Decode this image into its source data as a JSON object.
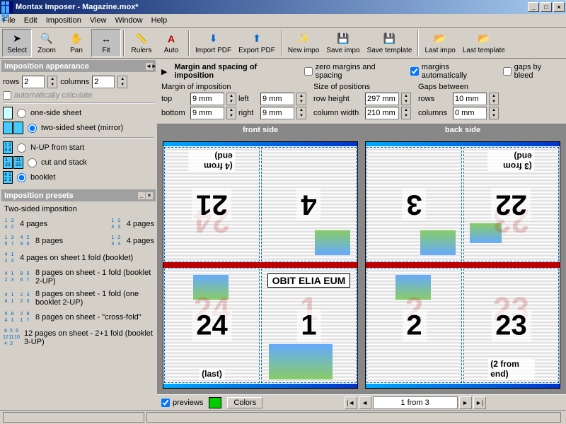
{
  "window": {
    "title": "Montax Imposer - Magazine.mox*"
  },
  "menu": {
    "file": "File",
    "edit": "Edit",
    "imposition": "Imposition",
    "view": "View",
    "window": "Window",
    "help": "Help"
  },
  "toolbar": {
    "select": "Select",
    "zoom": "Zoom",
    "pan": "Pan",
    "fit": "Fit",
    "rulers": "Rulers",
    "auto": "Auto",
    "importpdf": "Import PDF",
    "exportpdf": "Export PDF",
    "newimpo": "New impo",
    "saveimpo": "Save impo",
    "savetemplate": "Save template",
    "lastimpo": "Last impo",
    "lasttemplate": "Last template"
  },
  "appearance": {
    "header": "Imposition appearance",
    "rows_lbl": "rows",
    "rows_val": "2",
    "cols_lbl": "columns",
    "cols_val": "2",
    "autocalc": "automatically calculate",
    "oneside": "one-side sheet",
    "twoside": "two-sided sheet (mirror)",
    "nup": "N-UP from start",
    "cutstack": "cut and stack",
    "booklet": "booklet"
  },
  "presets": {
    "header": "Imposition presets",
    "subheader": "Two-sided imposition",
    "items": [
      "4 pages",
      "4 pages",
      "8 pages",
      "4 pages",
      "4 pages on sheet 1 fold (booklet)",
      "8 pages on sheet - 1 fold (booklet 2-UP)",
      "8 pages on sheet - 1 fold (one booklet 2-UP)",
      "8 pages on sheet - \"cross-fold\"",
      "12 pages on sheet - 2+1 fold (booklet 3-UP)"
    ]
  },
  "marginPanel": {
    "title": "Margin and spacing of imposition",
    "zero": "zero margins and spacing",
    "auto": "margins automatically",
    "gapsbleed": "gaps by bleed",
    "marginOf": "Margin of imposition",
    "top": "top",
    "top_v": "9 mm",
    "left": "left",
    "left_v": "9 mm",
    "bottom": "bottom",
    "bottom_v": "9 mm",
    "right": "right",
    "right_v": "9 mm",
    "sizeOf": "Size of positions",
    "rowh": "row height",
    "rowh_v": "297 mm",
    "colw": "column width",
    "colw_v": "210 mm",
    "gaps": "Gaps between",
    "grows": "rows",
    "grows_v": "10 mm",
    "gcols": "columns",
    "gcols_v": "0 mm"
  },
  "canvas": {
    "front": "front side",
    "back": "back side",
    "p21": "21",
    "p4": "4",
    "p24": "24",
    "p1": "1",
    "p3": "3",
    "p22": "22",
    "p2": "2",
    "p23": "23",
    "g24": "24",
    "g1": "1",
    "g2": "2",
    "g23": "23",
    "c4end": "(4 from end)",
    "c3end": "(3 from end)",
    "c2end": "(2 from end)",
    "clast": "(last)",
    "headline": "OBIT ELIA EUM"
  },
  "bottom": {
    "previews": "previews",
    "colors": "Colors",
    "nav": "1 from 3"
  }
}
